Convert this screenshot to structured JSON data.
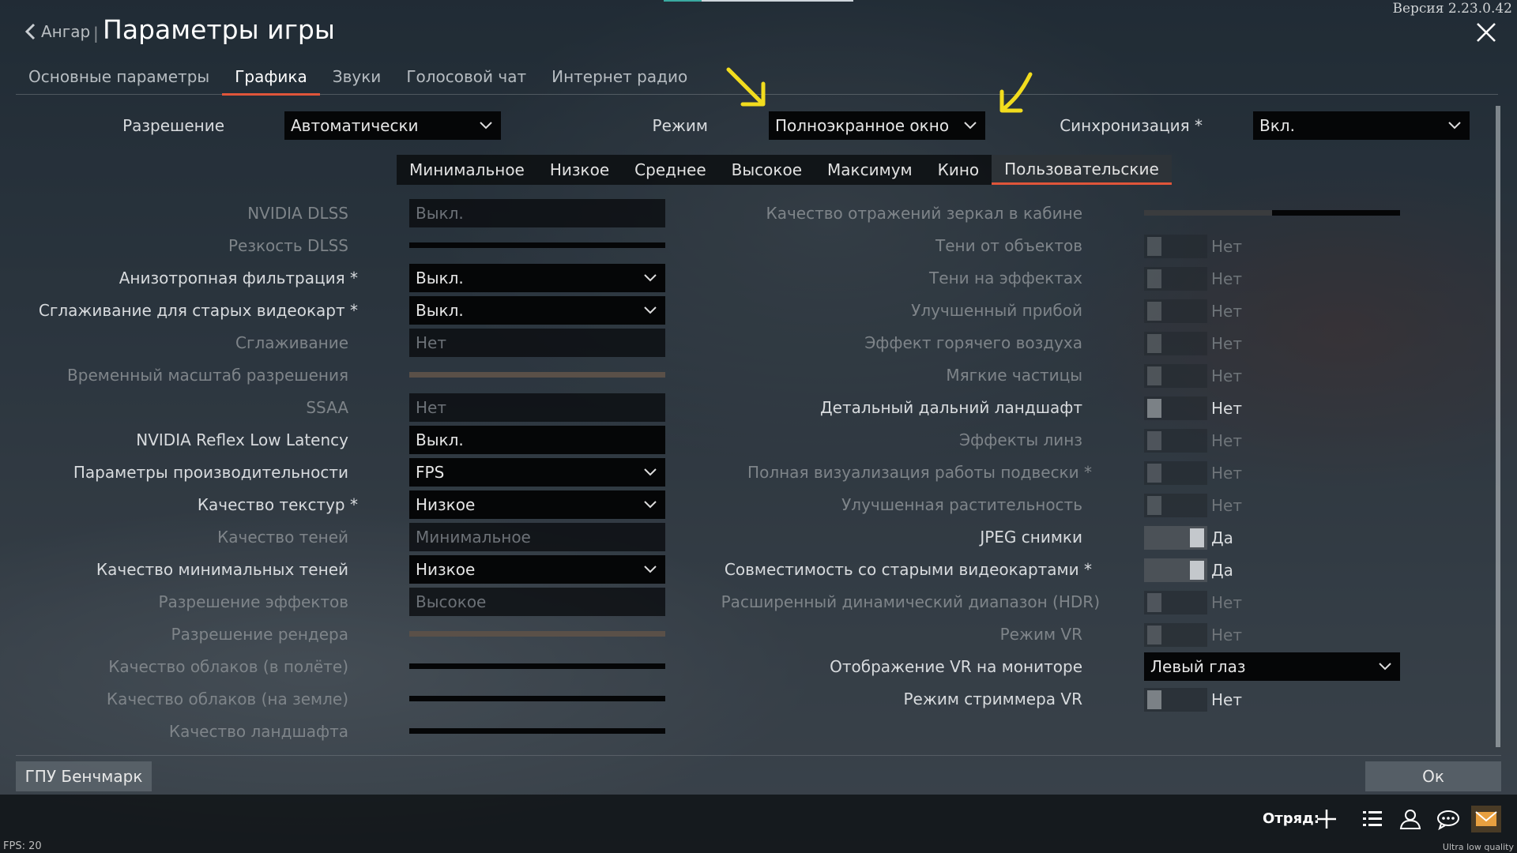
{
  "version": "Версия 2.23.0.42",
  "header": {
    "back_label": "Ангар",
    "separator": "|",
    "title": "Параметры игры"
  },
  "tabs": [
    "Основные параметры",
    "Графика",
    "Звуки",
    "Голосовой чат",
    "Интернет радио"
  ],
  "active_tab": "Графика",
  "top": {
    "resolution": {
      "label": "Разрешение",
      "value": "Автоматически"
    },
    "mode": {
      "label": "Режим",
      "value": "Полноэкранное окно"
    },
    "vsync": {
      "label": "Синхронизация *",
      "value": "Вкл."
    }
  },
  "presets": [
    "Минимальное",
    "Низкое",
    "Среднее",
    "Высокое",
    "Максимум",
    "Кино",
    "Пользовательские"
  ],
  "active_preset": "Пользовательские",
  "left": {
    "dlss": {
      "label": "NVIDIA DLSS",
      "value": "Выкл."
    },
    "dlss_sharp": {
      "label": "Резкость DLSS"
    },
    "aniso": {
      "label": "Анизотропная фильтрация *",
      "value": "Выкл."
    },
    "aa_old": {
      "label": "Сглаживание для старых видеокарт *",
      "value": "Выкл."
    },
    "aa": {
      "label": "Сглаживание",
      "value": "Нет"
    },
    "temporal": {
      "label": "Временный масштаб разрешения"
    },
    "ssaa": {
      "label": "SSAA",
      "value": "Нет"
    },
    "reflex": {
      "label": "NVIDIA Reflex Low Latency",
      "value": "Выкл."
    },
    "perf": {
      "label": "Параметры производительности",
      "value": "FPS"
    },
    "tex": {
      "label": "Качество текстур *",
      "value": "Низкое"
    },
    "shadows": {
      "label": "Качество теней",
      "value": "Минимальное"
    },
    "minshadows": {
      "label": "Качество минимальных теней",
      "value": "Низкое"
    },
    "fxres": {
      "label": "Разрешение эффектов",
      "value": "Высокое"
    },
    "renderres": {
      "label": "Разрешение рендера"
    },
    "clouds_air": {
      "label": "Качество облаков (в полёте)"
    },
    "clouds_ground": {
      "label": "Качество облаков (на земле)"
    },
    "landscape": {
      "label": "Качество ландшафта"
    }
  },
  "right": {
    "mirror": {
      "label": "Качество отражений зеркал в кабине",
      "level": 0.5
    },
    "obj_shadows": {
      "label": "Тени от объектов",
      "value": "Нет"
    },
    "fx_shadows": {
      "label": "Тени на эффектах",
      "value": "Нет"
    },
    "surf": {
      "label": "Улучшенный прибой",
      "value": "Нет"
    },
    "haze": {
      "label": "Эффект горячего воздуха",
      "value": "Нет"
    },
    "soft": {
      "label": "Мягкие частицы",
      "value": "Нет"
    },
    "far_land": {
      "label": "Детальный дальний ландшафт",
      "value": "Нет"
    },
    "lens": {
      "label": "Эффекты линз",
      "value": "Нет"
    },
    "susp": {
      "label": "Полная визуализация работы подвески *",
      "value": "Нет"
    },
    "grass": {
      "label": "Улучшенная растительность",
      "value": "Нет"
    },
    "jpeg": {
      "label": "JPEG снимки",
      "value": "Да"
    },
    "compat": {
      "label": "Совместимость со старыми видеокартами *",
      "value": "Да"
    },
    "hdr": {
      "label": "Расширенный динамический диапазон (HDR)",
      "value": "Нет"
    },
    "vr": {
      "label": "Режим VR",
      "value": "Нет"
    },
    "vr_mon": {
      "label": "Отображение VR на мониторе",
      "value": "Левый глаз"
    },
    "vr_stream": {
      "label": "Режим стриммера VR",
      "value": "Нет"
    }
  },
  "bottom": {
    "benchmark": "ГПУ Бенчмарк",
    "ok": "Ок",
    "squad": "Отряд:",
    "fps": "FPS: 20",
    "quality": "Ultra low quality"
  },
  "colors": {
    "accent": "#e0553a",
    "arrow": "#f2dc1e",
    "mail": "#e8a040"
  },
  "icons": [
    "chevron-left-icon",
    "close-icon",
    "chevron-down-icon",
    "plus-icon",
    "list-icon",
    "friends-icon",
    "chat-icon",
    "mail-icon",
    "arrow-annotation-icon"
  ]
}
